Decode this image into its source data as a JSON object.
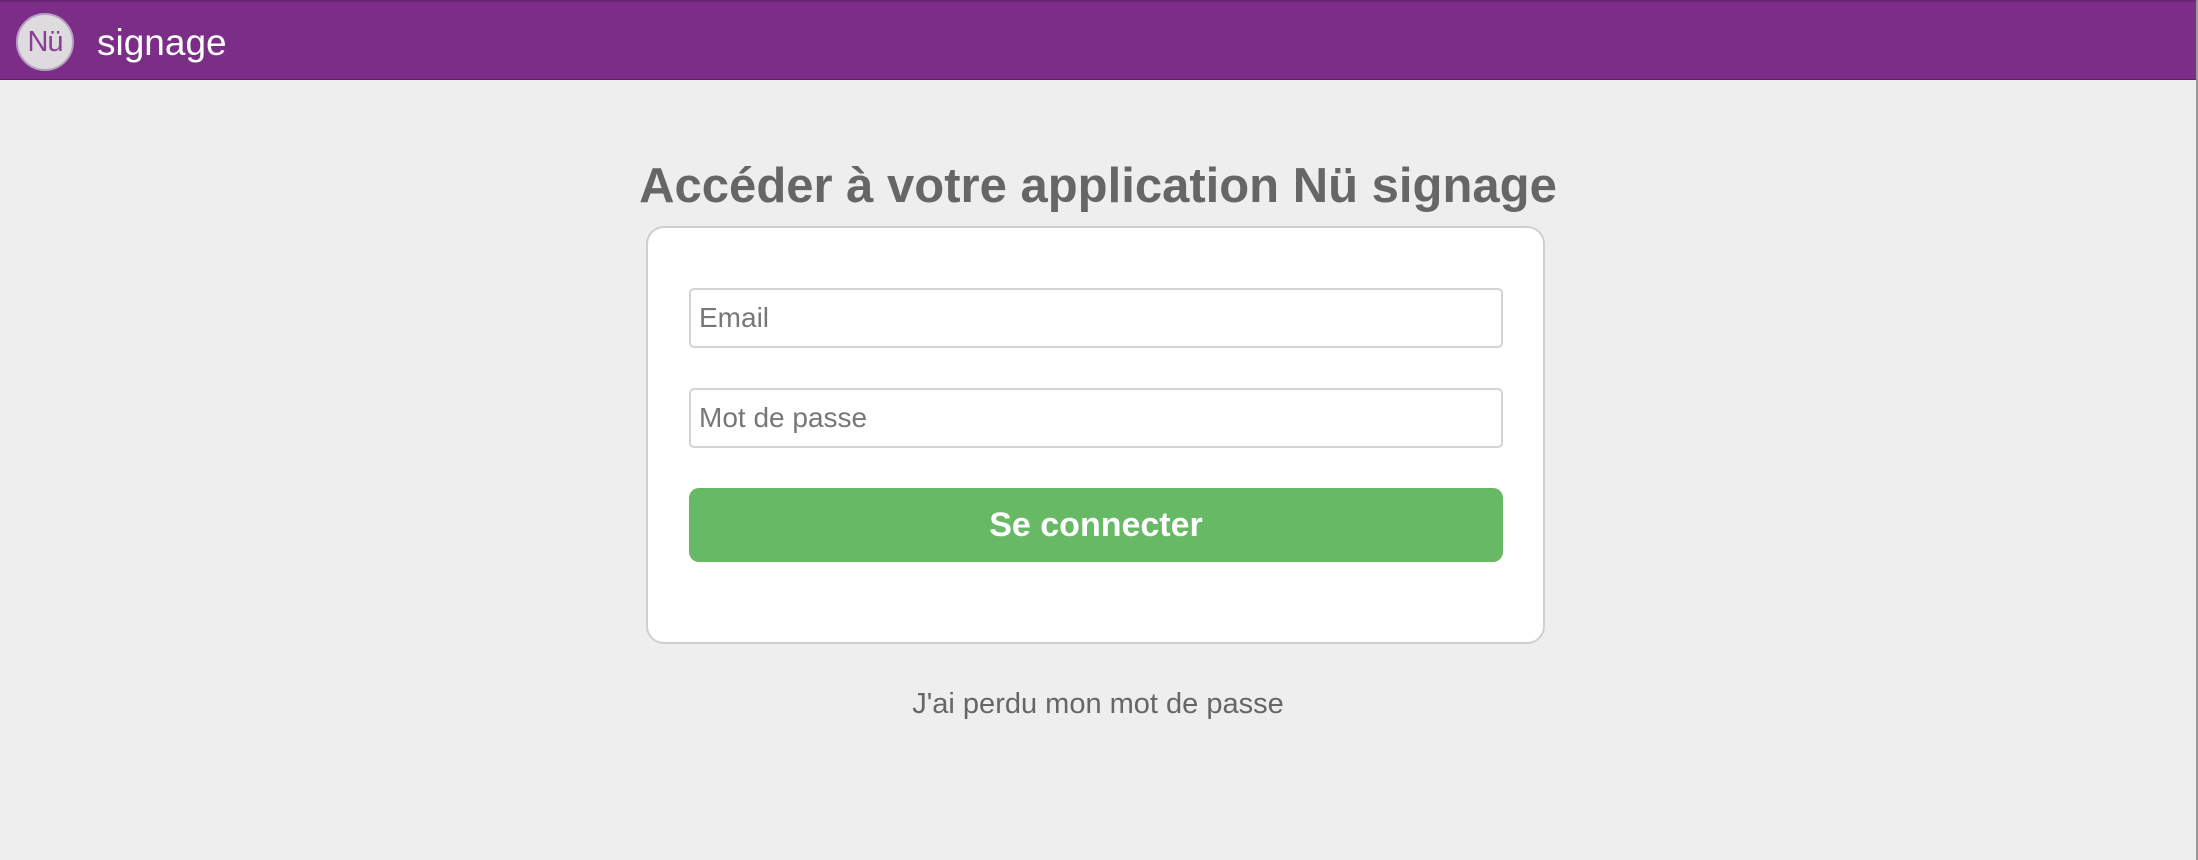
{
  "header": {
    "logo_text": "Nü",
    "brand": "signage",
    "color": "#7b2d87"
  },
  "main": {
    "title": "Accéder à votre application Nü signage",
    "email": {
      "value": "",
      "placeholder": "Email"
    },
    "password": {
      "value": "",
      "placeholder": "Mot de passe"
    },
    "submit_label": "Se connecter",
    "submit_color": "#67b965",
    "forgot_password_label": "J'ai perdu mon mot de passe"
  },
  "icons": {
    "logo": "nu-logo-icon"
  }
}
